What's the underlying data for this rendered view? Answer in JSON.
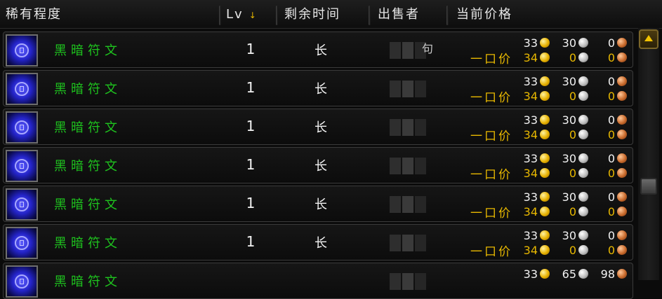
{
  "header": {
    "rarity": "稀有程度",
    "level": "Lv",
    "sort_indicator": "↓",
    "time_left": "剩余时间",
    "seller": "出售者",
    "current_price": "当前价格"
  },
  "icons": {
    "item": "rune-icon",
    "gold": "gold-coin-icon",
    "silver": "silver-coin-icon",
    "copper": "copper-coin-icon",
    "scroll_up": "scroll-up-arrow-icon"
  },
  "colors": {
    "item_name": "#1ec31e",
    "buyout": "#e8b800"
  },
  "rows": [
    {
      "name": "黑暗符文",
      "level": "1",
      "time": "长",
      "seller_tail": "句",
      "bid": {
        "gold": "33",
        "silver": "30",
        "copper": "0"
      },
      "buyout_label": "一口价",
      "buyout": {
        "gold": "34",
        "silver": "0",
        "copper": "0"
      }
    },
    {
      "name": "黑暗符文",
      "level": "1",
      "time": "长",
      "seller_tail": "",
      "bid": {
        "gold": "33",
        "silver": "30",
        "copper": "0"
      },
      "buyout_label": "一口价",
      "buyout": {
        "gold": "34",
        "silver": "0",
        "copper": "0"
      }
    },
    {
      "name": "黑暗符文",
      "level": "1",
      "time": "长",
      "seller_tail": "",
      "bid": {
        "gold": "33",
        "silver": "30",
        "copper": "0"
      },
      "buyout_label": "一口价",
      "buyout": {
        "gold": "34",
        "silver": "0",
        "copper": "0"
      }
    },
    {
      "name": "黑暗符文",
      "level": "1",
      "time": "长",
      "seller_tail": "",
      "bid": {
        "gold": "33",
        "silver": "30",
        "copper": "0"
      },
      "buyout_label": "一口价",
      "buyout": {
        "gold": "34",
        "silver": "0",
        "copper": "0"
      }
    },
    {
      "name": "黑暗符文",
      "level": "1",
      "time": "长",
      "seller_tail": "",
      "bid": {
        "gold": "33",
        "silver": "30",
        "copper": "0"
      },
      "buyout_label": "一口价",
      "buyout": {
        "gold": "34",
        "silver": "0",
        "copper": "0"
      }
    },
    {
      "name": "黑暗符文",
      "level": "1",
      "time": "长",
      "seller_tail": "",
      "bid": {
        "gold": "33",
        "silver": "30",
        "copper": "0"
      },
      "buyout_label": "一口价",
      "buyout": {
        "gold": "34",
        "silver": "0",
        "copper": "0"
      }
    },
    {
      "name": "黑暗符文",
      "level": "",
      "time": "",
      "seller_tail": "",
      "bid": {
        "gold": "33",
        "silver": "65",
        "copper": "98"
      },
      "buyout_label": "",
      "buyout": {
        "gold": "",
        "silver": "",
        "copper": ""
      }
    }
  ]
}
